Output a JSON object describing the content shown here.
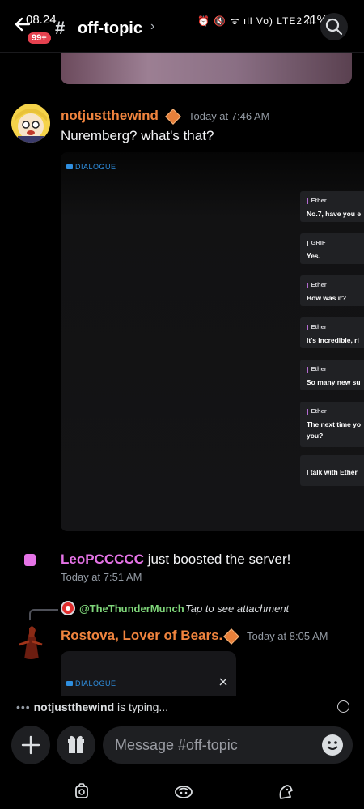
{
  "status_bar": {
    "time": "08.24",
    "icons": "⏰ 🔇 ᯤ ıll Vo) LTE2 ıll",
    "battery": "21%"
  },
  "header": {
    "back_icon": "arrow-left-icon",
    "unread_badge": "99+",
    "hash": "#",
    "channel_name": "off-topic",
    "chevron": "›",
    "search_icon": "search-icon"
  },
  "messages": [
    {
      "username": "notjustthewind",
      "username_color": "#f0843e",
      "timestamp": "Today at 7:46 AM",
      "text": "Nuremberg? what's that?",
      "embed": {
        "tag": "DIALOGUE",
        "lines": [
          {
            "speaker": "Ether",
            "text": "No.7, have you e"
          },
          {
            "speaker": "GRIF",
            "text": "Yes."
          },
          {
            "speaker": "Ether",
            "text": "How was it?"
          },
          {
            "speaker": "Ether",
            "text": "It's incredible, ri"
          },
          {
            "speaker": "Ether",
            "text": "So many new su"
          },
          {
            "speaker": "Ether",
            "text": "The next time yo\nyou?"
          },
          {
            "speaker": "",
            "text": "I talk with Ether"
          }
        ]
      }
    }
  ],
  "system_message": {
    "username": "LeoPCCCCC",
    "username_color": "#e573e6",
    "text": "just boosted the server!",
    "timestamp": "Today at 7:51 AM"
  },
  "reply_message": {
    "reply_to": "@TheThunderMunch",
    "reply_to_color": "#7fd67a",
    "reply_hint": "Tap to see attachment",
    "username": "Rostova, Lover of Bears.",
    "username_color": "#f0843e",
    "timestamp": "Today at 8:05 AM",
    "embed_tag": "DIALOGUE",
    "close_icon": "close-icon"
  },
  "typing": {
    "user": "notjustthewind",
    "suffix": " is typing..."
  },
  "composer": {
    "add_icon": "plus-icon",
    "gift_icon": "gift-icon",
    "placeholder": "Message #off-topic",
    "emoji_icon": "emoji-icon"
  },
  "bottom_nav": [
    {
      "icon": "home-icon"
    },
    {
      "icon": "notifications-icon"
    },
    {
      "icon": "profile-icon"
    }
  ]
}
